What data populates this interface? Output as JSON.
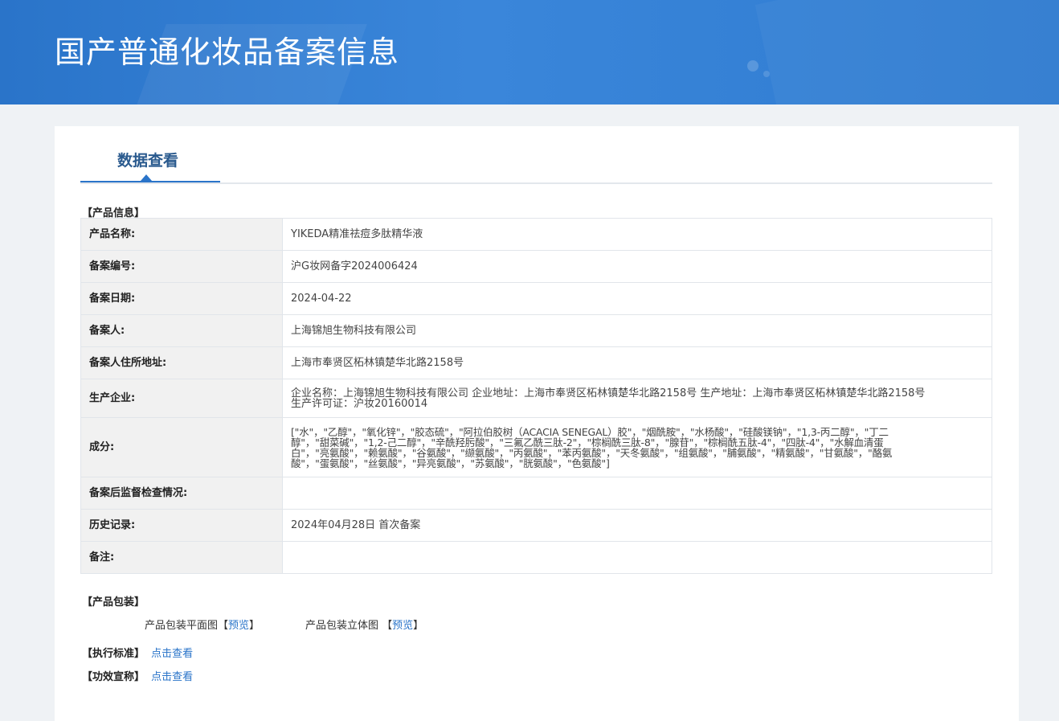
{
  "header": {
    "title": "国产普通化妆品备案信息"
  },
  "tabs": [
    {
      "label": "数据查看"
    }
  ],
  "sections": {
    "product_info": "【产品信息】",
    "packaging": "【产品包装】",
    "standard": "【执行标准】",
    "efficacy": "【功效宣称】"
  },
  "rows": [
    {
      "label": "产品名称:",
      "value": "YIKEDA精准祛痘多肽精华液"
    },
    {
      "label": "备案编号:",
      "value": "沪G妆网备字2024006424"
    },
    {
      "label": "备案日期:",
      "value": "2024-04-22"
    },
    {
      "label": "备案人:",
      "value": "上海锦旭生物科技有限公司"
    },
    {
      "label": "备案人住所地址:",
      "value": "上海市奉贤区柘林镇楚华北路2158号"
    },
    {
      "label": "生产企业:",
      "value_lines": [
        "企业名称：上海锦旭生物科技有限公司 企业地址：上海市奉贤区柘林镇楚华北路2158号 生产地址：上海市奉贤区柘林镇楚华北路2158号",
        "生产许可证：沪妆20160014"
      ]
    },
    {
      "label": "成分:",
      "value_lines": [
        "[\"水\"，\"乙醇\"，\"氧化锌\"，\"胶态硫\"，\"阿拉伯胶树（ACACIA SENEGAL）胶\"，\"烟酰胺\"，\"水杨酸\"，\"硅酸镁钠\"，\"1,3-丙二醇\"，\"丁二",
        "醇\"，\"甜菜碱\"，\"1,2-己二醇\"，\"辛酰羟肟酸\"，\"三氟乙酰三肽-2\"，\"棕榈酰三肽-8\"，\"腺苷\"，\"棕榈酰五肽-4\"，\"四肽-4\"，\"水解血清蛋",
        "白\"，\"亮氨酸\"，\"赖氨酸\"，\"谷氨酸\"，\"缬氨酸\"，\"丙氨酸\"，\"苯丙氨酸\"，\"天冬氨酸\"，\"组氨酸\"，\"脯氨酸\"，\"精氨酸\"，\"甘氨酸\"，\"酪氨",
        "酸\"，\"蛋氨酸\"，\"丝氨酸\"，\"异亮氨酸\"，\"苏氨酸\"，\"胱氨酸\"，\"色氨酸\"]"
      ]
    },
    {
      "label": "备案后监督检查情况:",
      "value": ""
    },
    {
      "label": "历史记录:",
      "value": "2024年04月28日 首次备案"
    },
    {
      "label": "备注:",
      "value": ""
    }
  ],
  "packaging": {
    "flat_label": "产品包装平面图【",
    "flat_link": "预览",
    "flat_close": "】",
    "solid_label": "产品包装立体图 【",
    "solid_link": "预览",
    "solid_close": "】"
  },
  "standard_link": "点击查看",
  "efficacy_link": "点击查看",
  "colors": {
    "header_blue": "#2a74c9",
    "link_blue": "#2a74c9",
    "label_bg": "#f1f1f1"
  }
}
